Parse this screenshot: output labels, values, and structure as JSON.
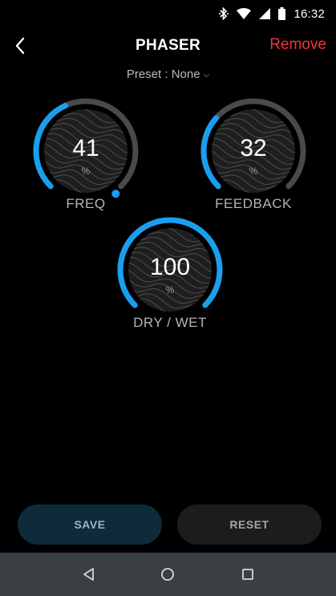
{
  "status": {
    "time": "16:32",
    "icons": [
      "bluetooth-icon",
      "wifi-icon",
      "signal-icon",
      "battery-icon"
    ]
  },
  "header": {
    "title": "PHASER",
    "remove_label": "Remove",
    "back_icon": "chevron-left-icon"
  },
  "preset": {
    "label": "Preset : None",
    "chevron_icon": "chevron-down-icon"
  },
  "knobs": [
    {
      "label": "FREQ",
      "value": "41",
      "unit": "%",
      "level": 0.41,
      "has_marker": true
    },
    {
      "label": "FEEDBACK",
      "value": "32",
      "unit": "%",
      "level": 0.32,
      "has_marker": false
    },
    {
      "label": "DRY / WET",
      "value": "100",
      "unit": "%",
      "level": 1.0,
      "has_marker": false
    }
  ],
  "buttons": {
    "save_label": "SAVE",
    "reset_label": "RESET"
  },
  "nav": {
    "icons": [
      "back-triangle-icon",
      "home-circle-icon",
      "recents-square-icon"
    ]
  },
  "colors": {
    "accent": "#1a9ef0",
    "track": "#4a4a4a",
    "remove": "#f0343c",
    "save_bg": "#0e2a3b",
    "reset_bg": "#1c1c1c"
  }
}
